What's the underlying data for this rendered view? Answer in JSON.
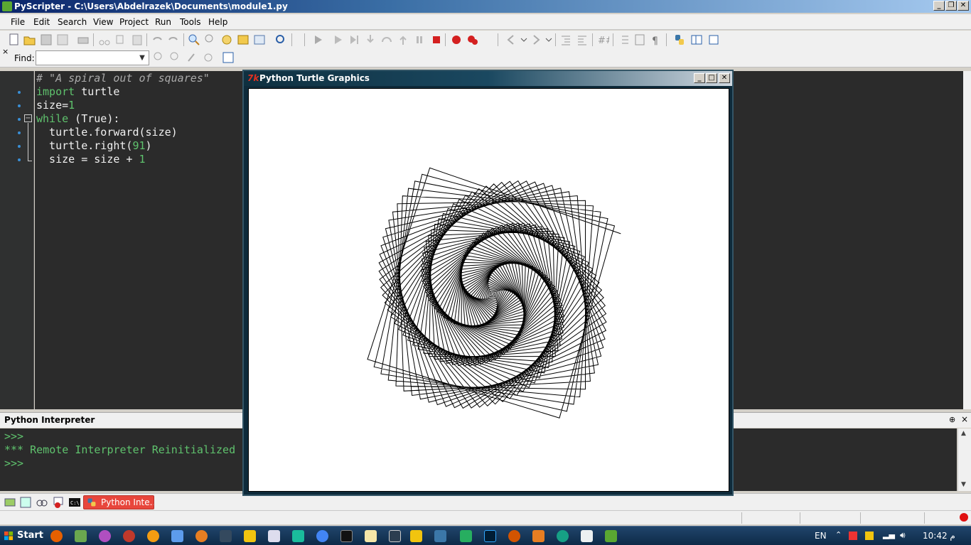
{
  "window": {
    "title": "PyScripter - C:\\Users\\Abdelrazek\\Documents\\module1.py",
    "controls": [
      "minimize",
      "restore",
      "close"
    ]
  },
  "menu": [
    "File",
    "Edit",
    "Search",
    "View",
    "Project",
    "Run",
    "Tools",
    "Help"
  ],
  "find": {
    "label": "Find:",
    "value": ""
  },
  "editor": {
    "lines": [
      "# \"A spiral out of squares\"",
      "import turtle",
      "size=1",
      "while (True):",
      "  turtle.forward(size)",
      "  turtle.right(91)",
      "  size = size + 1"
    ]
  },
  "interpreter": {
    "title": "Python Interpreter",
    "lines": [
      ">>>",
      "*** Remote Interpreter Reinitialized",
      ">>>"
    ]
  },
  "bottom_tabs": {
    "active_label": "Python Inte..."
  },
  "turtle": {
    "title": "Python Turtle Graphics",
    "icon_text": "7k",
    "spiral": {
      "angle_deg": 91,
      "start_size": 1,
      "step": 1,
      "steps_drawn": 290
    }
  },
  "taskbar": {
    "start_label": "Start",
    "language": "EN",
    "clock": "10:42 م"
  },
  "colors": {
    "editor_bg": "#2b2b2b",
    "keyword": "#5fc26d",
    "comment": "#aaaaaa",
    "active_tab": "#e8463c",
    "taskbar": "#14365a"
  }
}
